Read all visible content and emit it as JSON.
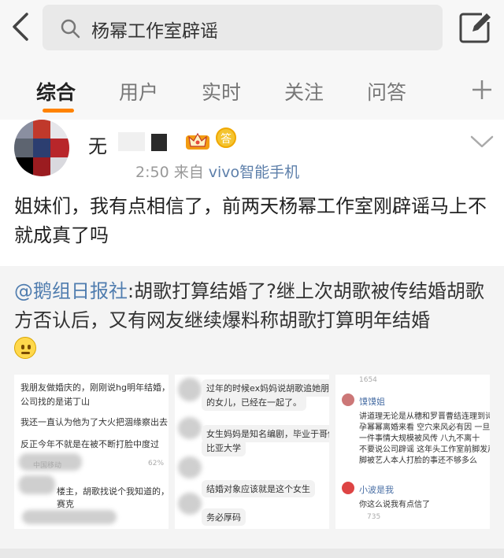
{
  "search": {
    "query": "杨幂工作室辟谣"
  },
  "tabs": [
    {
      "label": "综合"
    },
    {
      "label": "用户"
    },
    {
      "label": "实时"
    },
    {
      "label": "关注"
    },
    {
      "label": "问答"
    }
  ],
  "post": {
    "username": "无",
    "time": "2:50",
    "source_prefix": "来自",
    "source": "vivo智能手机",
    "badge_circle": "答",
    "text": "姐妹们，我有点相信了，前两天杨幂工作室刚辟谣马上不就成真了吗"
  },
  "repost": {
    "mention": "@鹅组日报社",
    "text": ":胡歌打算结婚了?继上次胡歌被传结婚胡歌方否认后，又有网友继续爆料称胡歌打算明年结婚"
  },
  "thumb1": {
    "line1": "我朋友做婚庆的，刚刚说hg明年结婚，婚庆",
    "line2": "公司找的是诺丁山",
    "line3": "我还一直认为他为了大火把涸缘察出去了",
    "line4": "反正今年不就是在被不断打脸中度过",
    "status": "中国移动",
    "battery": "62%",
    "reply": "楼主，胡歌找说个我知道的，请马",
    "reply2": "赛克"
  },
  "thumb2": {
    "line1": "过年的时候ex妈妈说胡歌追她朋友",
    "line2": "的女儿，已经在一起了。",
    "line3": "女生妈妈是知名编剧，毕业于哥伦",
    "line4": "比亚大学",
    "line5": "结婚对象应该就是这个女生",
    "line6": "务必厚码"
  },
  "thumb3": {
    "count_top": "1654",
    "user1": "馍馍姐",
    "line1": "讲道理无论是从穗和罗晋曹结连理到诗诗怀",
    "line2": "孕幂幂离婚来看 空穴来风必有因 一旦YLQ",
    "line3": "一件事情大规模被风传 八九不离十",
    "line4": "不要说公司辟谣 这年头工作室前脚发声明后",
    "line5": "脚被艺人本人打脸的事还不够多么",
    "user2": "小波是我",
    "line6": "你这么说我有点信了",
    "count_bottom": "735"
  },
  "colors": {
    "accent": "#ff8200",
    "link": "#507daf"
  }
}
